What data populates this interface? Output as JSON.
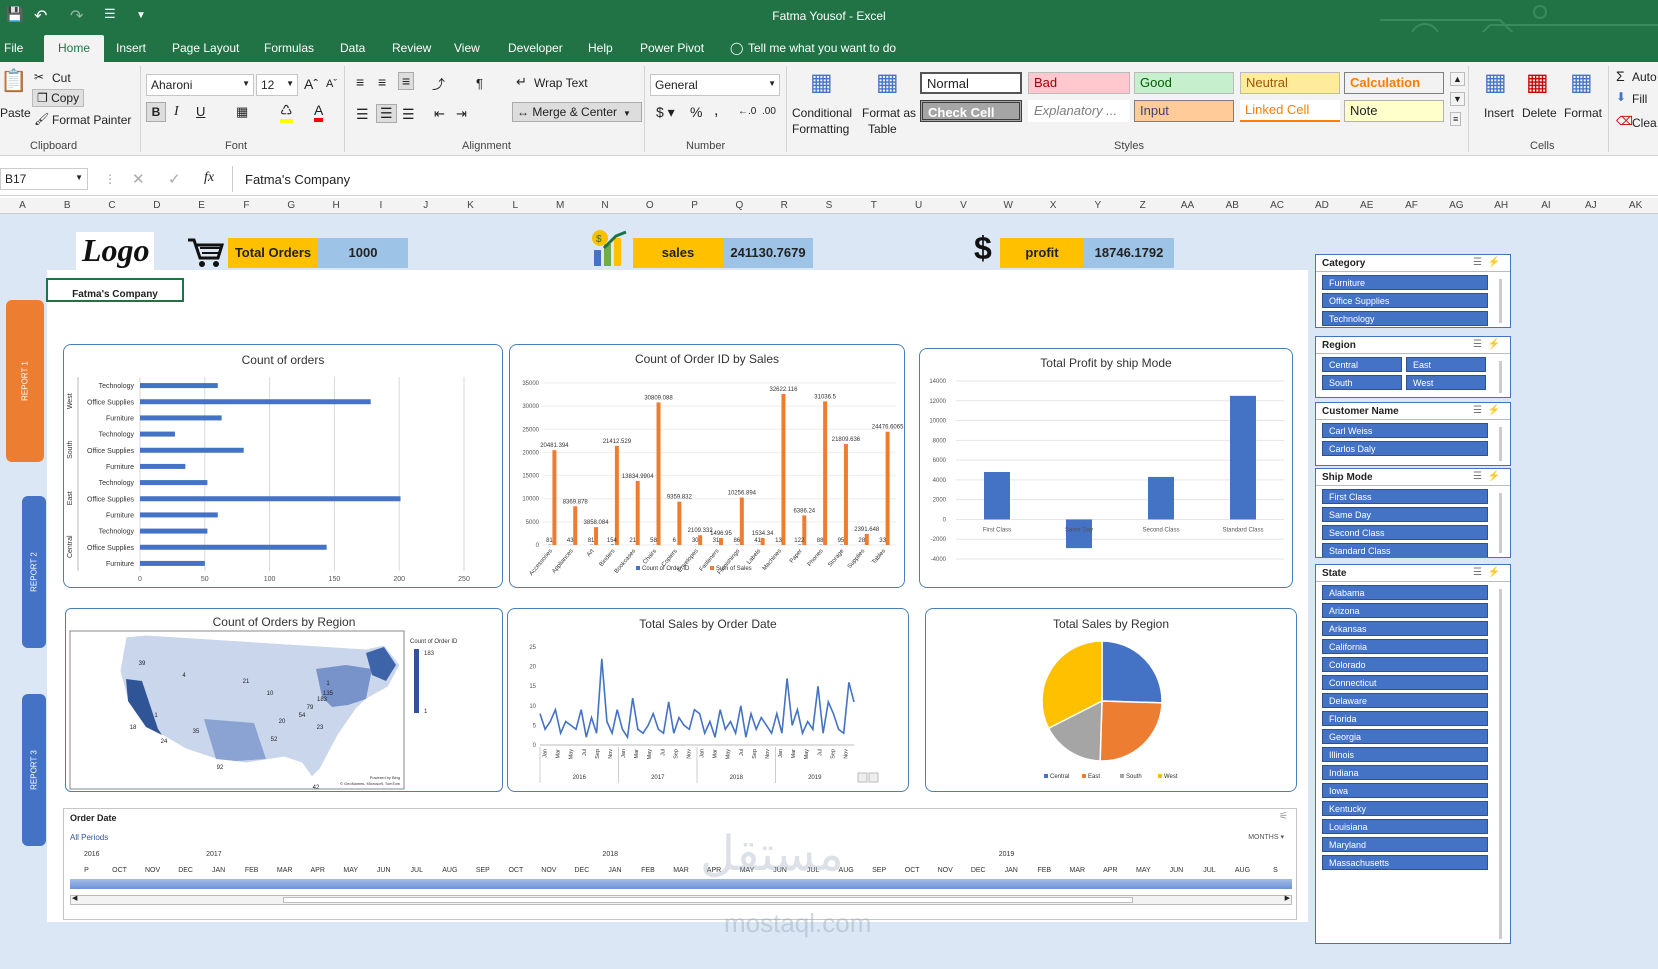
{
  "window": {
    "title": "Fatma Yousof  -  Excel"
  },
  "ribbon_tabs": [
    "File",
    "Home",
    "Insert",
    "Page Layout",
    "Formulas",
    "Data",
    "Review",
    "View",
    "Developer",
    "Help",
    "Power Pivot"
  ],
  "tell_me": "Tell me what you want to do",
  "clipboard": {
    "cut": "Cut",
    "copy": "Copy",
    "paste": "Paste",
    "format_painter": "Format Painter",
    "label": "Clipboard"
  },
  "font": {
    "name": "Aharoni",
    "size": "12",
    "label": "Font"
  },
  "alignment": {
    "wrap": "Wrap Text",
    "merge": "Merge & Center",
    "label": "Alignment"
  },
  "number": {
    "format": "General",
    "label": "Number"
  },
  "styles": {
    "conditional": "Conditional",
    "formatting": "Formatting",
    "format_as": "Format as",
    "table": "Table",
    "label": "Styles",
    "cells": [
      "Normal",
      "Bad",
      "Good",
      "Neutral",
      "Calculation",
      "Check Cell",
      "Explanatory ...",
      "Input",
      "Linked Cell",
      "Note"
    ]
  },
  "cells": {
    "insert": "Insert",
    "delete": "Delete",
    "format": "Format",
    "label": "Cells"
  },
  "editing": {
    "autosum": "Auto",
    "fill": "Fill",
    "clear": "Clea"
  },
  "formula_bar": {
    "name_box": "B17",
    "value": "Fatma's Company"
  },
  "columns": [
    "A",
    "B",
    "C",
    "D",
    "E",
    "F",
    "G",
    "H",
    "I",
    "J",
    "K",
    "L",
    "M",
    "N",
    "O",
    "P",
    "Q",
    "R",
    "S",
    "T",
    "U",
    "V",
    "W",
    "X",
    "Y",
    "Z",
    "AA",
    "AB",
    "AC",
    "AD",
    "AE",
    "AF",
    "AG",
    "AH",
    "AI",
    "AJ",
    "AK"
  ],
  "logo": {
    "text": "Logo",
    "company": "Fatma's Company"
  },
  "kpis": {
    "orders_label": "Total Orders",
    "orders_value": "1000",
    "sales_label": "sales",
    "sales_value": "241130.7679",
    "profit_label": "profit",
    "profit_value": "18746.1792"
  },
  "report_buttons": [
    "REPORT 1",
    "REPORT 2",
    "REPORT 3"
  ],
  "chart_orders_region_cat": {
    "title": "Count of  orders",
    "type": "bar",
    "groups": [
      "West",
      "South",
      "East",
      "Central"
    ],
    "categories": [
      "Technology",
      "Office Supplies",
      "Furniture",
      "Technology",
      "Office Supplies",
      "Furniture",
      "Technology",
      "Office Supplies",
      "Furniture",
      "Technology",
      "Office Supplies",
      "Furniture"
    ],
    "values": [
      60,
      178,
      63,
      27,
      80,
      35,
      52,
      201,
      60,
      52,
      144,
      50
    ],
    "xticks": [
      "0",
      "50",
      "100",
      "150",
      "200",
      "250"
    ],
    "xlim": [
      0,
      250
    ]
  },
  "chart_id_by_sales": {
    "title": "Count of Order ID by Sales",
    "type": "bar",
    "categories": [
      "Accessories",
      "Appliances",
      "Art",
      "Binders",
      "Bookcases",
      "Chairs",
      "Copiers",
      "Envelopes",
      "Fasteners",
      "Furnishings",
      "Labels",
      "Machines",
      "Paper",
      "Phones",
      "Storage",
      "Supplies",
      "Tables"
    ],
    "series": [
      {
        "name": "Count of Order ID",
        "values": [
          81,
          43,
          81,
          154,
          21,
          58,
          6,
          30,
          31,
          86,
          41,
          13,
          122,
          88,
          95,
          28,
          33
        ]
      },
      {
        "name": "Sum of Sales",
        "values": [
          20481.394,
          8369.878,
          3858.084,
          21412.529,
          13834.9904,
          30809.088,
          9359.832,
          2109.332,
          1496.95,
          10256.894,
          1534.34,
          32622.116,
          6386.24,
          31036.5,
          21809.636,
          2391.648,
          24476.6065
        ]
      }
    ],
    "count_labels": [
      "81",
      "43",
      "81",
      "154",
      "21",
      "58",
      "6",
      "30",
      "31",
      "86",
      "41",
      "13",
      "122",
      "88",
      "95",
      "28",
      "33"
    ],
    "sales_labels": [
      "20481.394",
      "8369.878",
      "3858.084",
      "21412.529",
      "13834.9904",
      "30809.088",
      "9359.832",
      "2109.332",
      "1496.95",
      "10256.894",
      "1534.34",
      "32622.116",
      "6386.24",
      "31036.5",
      "21809.636",
      "2391.648",
      "24476.6065"
    ],
    "yticks": [
      "0",
      "5000",
      "10000",
      "15000",
      "20000",
      "25000",
      "30000",
      "35000"
    ],
    "ylim": [
      0,
      35000
    ]
  },
  "chart_profit_ship": {
    "title": "Total Profit by ship Mode",
    "type": "bar",
    "categories": [
      "First Class",
      "Same Day",
      "Second Class",
      "Standard Class"
    ],
    "values": [
      4800,
      -2900,
      4300,
      12500
    ],
    "yticks": [
      "-4000",
      "-2000",
      "0",
      "2000",
      "4000",
      "6000",
      "8000",
      "10000",
      "12000",
      "14000"
    ],
    "ylim": [
      -4000,
      14000
    ]
  },
  "chart_map": {
    "title": "Count of Orders by Region",
    "legend_title": "Count of Order ID",
    "legend_max": "183",
    "legend_min": "1",
    "labels": [
      "39",
      "4",
      "21",
      "10",
      "135",
      "1",
      "35",
      "52",
      "20",
      "54",
      "79",
      "183",
      "1",
      "18",
      "23",
      "24",
      "92",
      "42"
    ],
    "attribution": "Powered by Bing",
    "attribution2": "© GeoNames, Microsoft, TomTom"
  },
  "chart_sales_date": {
    "title": "Total Sales by Order Date",
    "type": "line",
    "values": [
      8,
      4,
      6,
      9,
      3,
      6,
      5,
      4,
      9,
      2,
      7,
      3,
      22,
      6,
      3,
      9,
      4,
      2,
      12,
      4,
      3,
      5,
      8,
      4,
      3,
      11,
      3,
      7,
      5,
      4,
      9,
      8,
      3,
      6,
      2,
      9,
      4,
      6,
      3,
      10,
      2,
      8,
      4,
      7,
      5,
      3,
      8,
      3,
      17,
      5,
      9,
      3,
      6,
      4,
      15,
      3,
      11,
      8,
      4,
      3,
      16,
      11
    ],
    "yticks": [
      "0",
      "5",
      "10",
      "15",
      "20",
      "25"
    ],
    "ylim": [
      0,
      25
    ],
    "months": [
      "Jan",
      "Mar",
      "May",
      "Jul",
      "Sep",
      "Nov",
      "Jan",
      "Mar",
      "May",
      "Jul",
      "Sep",
      "Nov",
      "Jan",
      "Mar",
      "May",
      "Jul",
      "Sep",
      "Nov",
      "Jan",
      "Mar",
      "May",
      "Jul",
      "Sep",
      "Nov"
    ],
    "years": [
      "2016",
      "2017",
      "2018",
      "2019"
    ]
  },
  "chart_sales_region": {
    "title": "Total Sales by Region",
    "type": "pie",
    "categories": [
      "Central",
      "East",
      "South",
      "West"
    ],
    "values": [
      25.5,
      25.0,
      17.0,
      32.5
    ],
    "colors": [
      "#4472c4",
      "#ed7d31",
      "#a5a5a5",
      "#ffc000"
    ]
  },
  "timeline": {
    "header": "Order Date",
    "all_periods": "All Periods",
    "unit": "MONTHS",
    "years": [
      "2016",
      "2017",
      "2018",
      "2019"
    ],
    "months": [
      "P",
      "OCT",
      "NOV",
      "DEC",
      "JAN",
      "FEB",
      "MAR",
      "APR",
      "MAY",
      "JUN",
      "JUL",
      "AUG",
      "SEP",
      "OCT",
      "NOV",
      "DEC",
      "JAN",
      "FEB",
      "MAR",
      "APR",
      "MAY",
      "JUN",
      "JUL",
      "AUG",
      "SEP",
      "OCT",
      "NOV",
      "DEC",
      "JAN",
      "FEB",
      "MAR",
      "APR",
      "MAY",
      "JUN",
      "JUL",
      "AUG",
      "S"
    ]
  },
  "slicers": {
    "category": {
      "title": "Category",
      "items": [
        "Furniture",
        "Office Supplies",
        "Technology"
      ]
    },
    "region": {
      "title": "Region",
      "items": [
        "Central",
        "East",
        "South",
        "West"
      ]
    },
    "customer": {
      "title": "Customer Name",
      "items": [
        "Carl Weiss",
        "Carlos Daly"
      ]
    },
    "ship_mode": {
      "title": "Ship Mode",
      "items": [
        "First Class",
        "Same Day",
        "Second Class",
        "Standard Class"
      ]
    },
    "state": {
      "title": "State",
      "items": [
        "Alabama",
        "Arizona",
        "Arkansas",
        "California",
        "Colorado",
        "Connecticut",
        "Delaware",
        "Florida",
        "Georgia",
        "Illinois",
        "Indiana",
        "Iowa",
        "Kentucky",
        "Louisiana",
        "Maryland",
        "Massachusetts"
      ]
    }
  },
  "watermark": {
    "arabic": "مستقل",
    "latin": "mostaql.com"
  },
  "colors": {
    "excel_green": "#217346",
    "blue": "#4472c4",
    "orange": "#ed7d31",
    "kpi_yellow": "#ffc000",
    "kpi_blue": "#9dc3e6"
  }
}
